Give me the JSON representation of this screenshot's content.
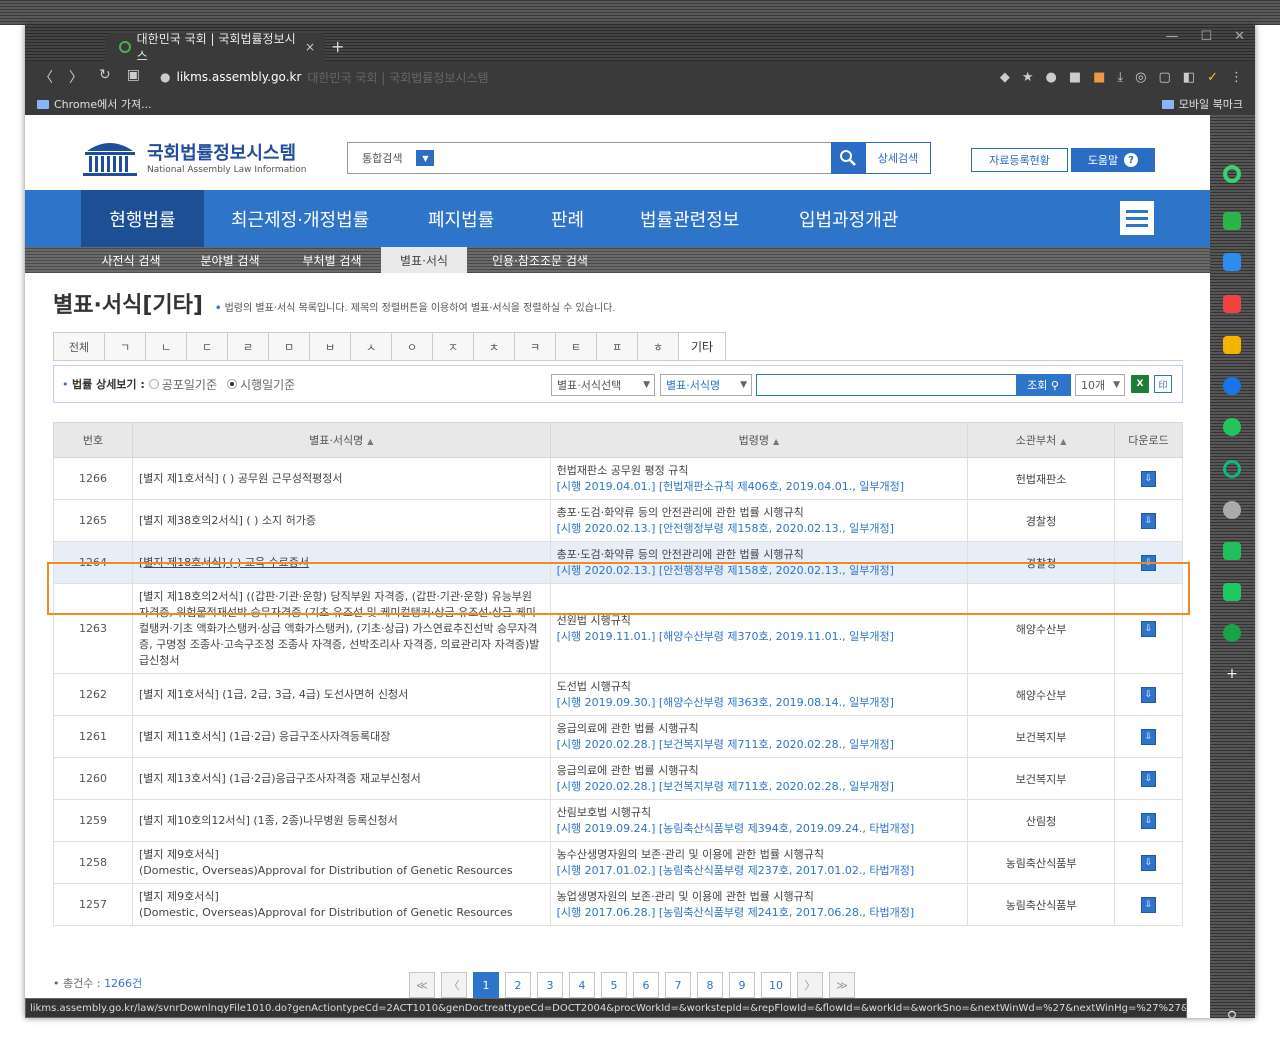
{
  "browser": {
    "tab_title": "대한민국 국회 | 국회법률정보시스",
    "tab_close": "×",
    "new_tab": "+",
    "url_host": "likms.assembly.go.kr",
    "url_rest": "대한민국 국회 | 국회법률정보시스템",
    "bookmark_left": "Chrome에서 가져...",
    "bookmark_right": "모바일 북마크",
    "status_url": "likms.assembly.go.kr/law/svnrDownlnqyFile1010.do?genActiontypeCd=2ACT1010&genDoctreattypeCd=DOCT2004&procWorkId=&workstepId=&repFlowId=&flowId=&workId=&workSno=&nextWinWd=%27&nextWinHg=%27%27&nex..."
  },
  "header": {
    "logo_title": "국회법률정보시스템",
    "logo_sub": "National Assembly Law Information",
    "search_scope": "통합검색",
    "adv_search": "상세검색",
    "reg_status": "자료등록현황",
    "help": "도움말",
    "help_q": "?"
  },
  "mainnav": [
    "현행법률",
    "최근제정·개정법률",
    "폐지법률",
    "판례",
    "법률관련정보",
    "입법과정개관"
  ],
  "subnav": [
    "사전식 검색",
    "분야별 검색",
    "부처별 검색",
    "별표·서식",
    "인용·참조조문 검색"
  ],
  "page": {
    "title": "별표·서식[기타]",
    "desc_bullet": "•",
    "desc": "법령의 별표·서식 목록입니다. 제목의 정렬버튼을 이용하여 별표·서식을 정렬하실 수 있습니다."
  },
  "char_tabs": [
    "전체",
    "ㄱ",
    "ㄴ",
    "ㄷ",
    "ㄹ",
    "ㅁ",
    "ㅂ",
    "ㅅ",
    "ㅇ",
    "ㅈ",
    "ㅊ",
    "ㅋ",
    "ㅌ",
    "ㅍ",
    "ㅎ",
    "기타"
  ],
  "filter": {
    "label": "법률 상세보기 :",
    "radio1": "공포일기준",
    "radio2": "시행일기준",
    "select1": "별표·서식선택",
    "select2": "별표·서식명",
    "query": "조회",
    "per_page": "10개",
    "excel": "X",
    "print": "印"
  },
  "table": {
    "headers": [
      "번호",
      "별표·서식명",
      "법령명",
      "소관부처",
      "다운로드"
    ],
    "rows": [
      {
        "num": "1266",
        "form": "[별지 제1호서식] (    ) 공무원 근무성적평정서",
        "law": "헌법재판소 공무원 평정 규칙",
        "law_sub": "[시행 2019.04.01.] [헌법재판소규칙 제406호, 2019.04.01., 일부개정]",
        "dept": "헌법재판소"
      },
      {
        "num": "1265",
        "form": "[별지 제38호의2서식] (   ) 소지 허가증",
        "law": "총포·도검·화약류 등의 안전관리에 관한 법률 시행규칙",
        "law_sub": "[시행 2020.02.13.] [안전행정부령 제158호, 2020.02.13., 일부개정]",
        "dept": "경찰청"
      },
      {
        "num": "1264",
        "form": "[별지 제18호서식] (   ) 교육 수료증서",
        "law": "총포·도검·화약류 등의 안전관리에 관한 법률 시행규칙",
        "law_sub": "[시행 2020.02.13.] [안전행정부령 제158호, 2020.02.13., 일부개정]",
        "dept": "경찰청"
      },
      {
        "num": "1263",
        "form": "[별지 제18호의2서식] ((갑판·기관·운항) 당직부원 자격증, (갑판·기관·운항) 유능부원 자격증, 위험물적재선박 승무자격증 (기초 유조선 및 케미컬탱커·상급 유조선·상급 케미컬탱커·기초 액화가스탱커·상급 액화가스탱커), (기초·상급) 가스연료추진선박 승무자격증, 구명정 조종사·고속구조정 조종사 자격증, 선박조리사 자격증, 의료관리자 자격증)발급신청서",
        "law": "선원법 시행규칙",
        "law_sub": "[시행 2019.11.01.] [해양수산부령 제370호, 2019.11.01., 일부개정]",
        "dept": "해양수산부"
      },
      {
        "num": "1262",
        "form": "[별지 제1호서식] (1급, 2급, 3급, 4급) 도선사면허 신청서",
        "law": "도선법 시행규칙",
        "law_sub": "[시행 2019.09.30.] [해양수산부령 제363호, 2019.08.14., 일부개정]",
        "dept": "해양수산부"
      },
      {
        "num": "1261",
        "form": "[별지 제11호서식] (1급·2급) 응급구조사자격등록대장",
        "law": "응급의료에 관한 법률 시행규칙",
        "law_sub": "[시행 2020.02.28.] [보건복지부령 제711호, 2020.02.28., 일부개정]",
        "dept": "보건복지부"
      },
      {
        "num": "1260",
        "form": "[별지 제13호서식] (1급·2급)응급구조사자격증 재교부신청서",
        "law": "응급의료에 관한 법률 시행규칙",
        "law_sub": "[시행 2020.02.28.] [보건복지부령 제711호, 2020.02.28., 일부개정]",
        "dept": "보건복지부"
      },
      {
        "num": "1259",
        "form": "[별지 제10호의12서식] (1종, 2종)나무병원 등록신청서",
        "law": "산림보호법 시행규칙",
        "law_sub": "[시행 2019.09.24.] [농림축산식품부령 제394호, 2019.09.24., 타법개정]",
        "dept": "산림청"
      },
      {
        "num": "1258",
        "form": "[별지 제9호서식]",
        "form2": "(Domestic, Overseas)Approval for Distribution of Genetic Resources",
        "law": "농수산생명자원의 보존·관리 및 이용에 관한 법률 시행규칙",
        "law_sub": "[시행 2017.01.02.] [농림축산식품부령 제237호, 2017.01.02., 타법개정]",
        "dept": "농림축산식품부"
      },
      {
        "num": "1257",
        "form": "[별지 제9호서식]",
        "form2": "(Domestic, Overseas)Approval for Distribution of Genetic Resources",
        "law": "농업생명자원의 보존·관리 및 이용에 관한 법률 시행규칙",
        "law_sub": "[시행 2017.06.28.] [농림축산식품부령 제241호, 2017.06.28., 타법개정]",
        "dept": "농림축산식품부"
      }
    ]
  },
  "footer": {
    "total_label": "총건수 : ",
    "total_count": "1266건",
    "pages": [
      "1",
      "2",
      "3",
      "4",
      "5",
      "6",
      "7",
      "8",
      "9",
      "10"
    ],
    "first": "≪",
    "prev": "〈",
    "next": "〉",
    "last": "≫"
  },
  "colors": {
    "brand": "#2e74c9",
    "nav_active": "#1d4f95",
    "highlight": "#f08a24"
  }
}
